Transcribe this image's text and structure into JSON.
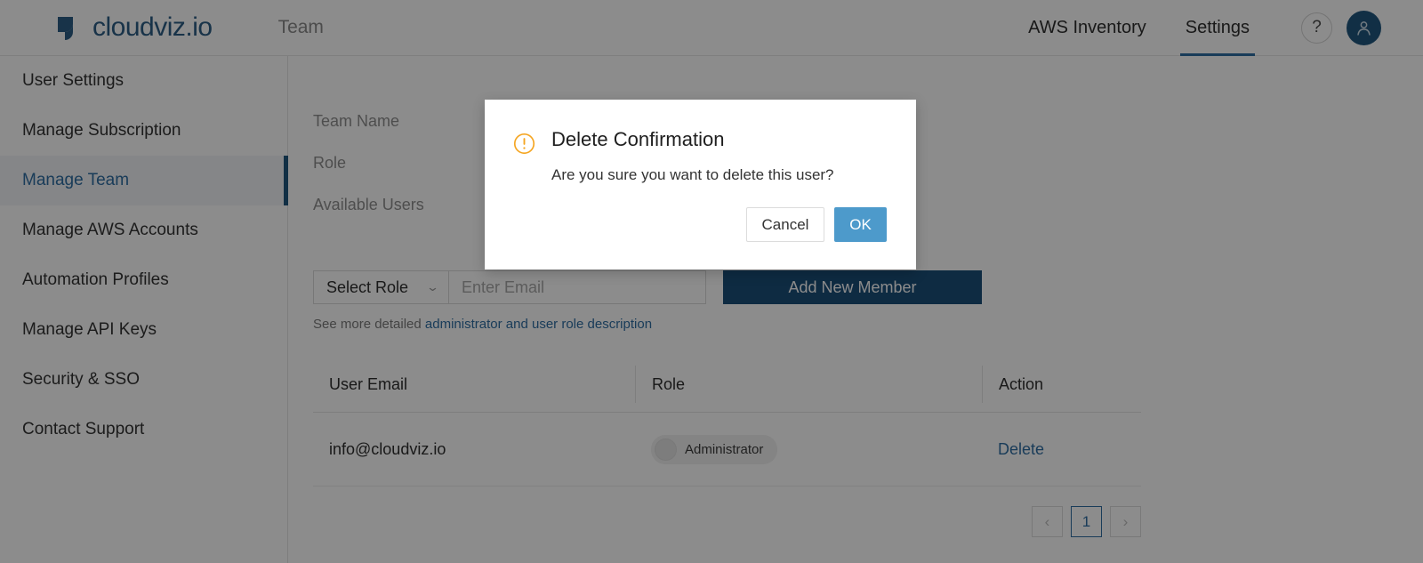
{
  "header": {
    "logo_text": "cloudviz.io",
    "logo_icon": "cloudviz-logo-icon",
    "page_title": "Team",
    "nav": [
      {
        "label": "AWS Inventory",
        "active": false
      },
      {
        "label": "Settings",
        "active": true
      }
    ],
    "help_label": "?",
    "help_icon": "question-mark-icon",
    "avatar_icon": "user-avatar-icon"
  },
  "sidebar": {
    "items": [
      {
        "label": "User Settings",
        "active": false
      },
      {
        "label": "Manage Subscription",
        "active": false
      },
      {
        "label": "Manage Team",
        "active": true
      },
      {
        "label": "Manage AWS Accounts",
        "active": false
      },
      {
        "label": "Automation Profiles",
        "active": false
      },
      {
        "label": "Manage API Keys",
        "active": false
      },
      {
        "label": "Security & SSO",
        "active": false
      },
      {
        "label": "Contact Support",
        "active": false
      }
    ]
  },
  "main": {
    "labels": {
      "team_name": "Team Name",
      "role": "Role",
      "available_users": "Available Users"
    },
    "controls": {
      "select_role_value": "Select Role",
      "select_role_caret": "chevron-down-icon",
      "email_placeholder": "Enter Email",
      "email_value": "",
      "add_member_label": "Add New Member"
    },
    "helper": {
      "prefix": "See more detailed ",
      "link": "administrator and user role description"
    },
    "table": {
      "columns": [
        "User Email",
        "Role",
        "Action"
      ],
      "rows": [
        {
          "email": "info@cloudviz.io",
          "role": "Administrator",
          "role_toggle_on": false,
          "action": "Delete"
        }
      ]
    },
    "pagination": {
      "prev": "‹",
      "next": "›",
      "pages": [
        "1"
      ],
      "current": "1"
    }
  },
  "modal": {
    "icon": "warning-circle-icon",
    "title": "Delete Confirmation",
    "message": "Are you sure you want to delete this user?",
    "cancel_label": "Cancel",
    "ok_label": "OK"
  },
  "colors": {
    "brand_navy": "#1b4f78",
    "accent_blue": "#2f6da3",
    "ok_blue": "#4d9acb",
    "warning_orange": "#f5a623",
    "overlay": "rgba(0,0,0,0.45)"
  }
}
